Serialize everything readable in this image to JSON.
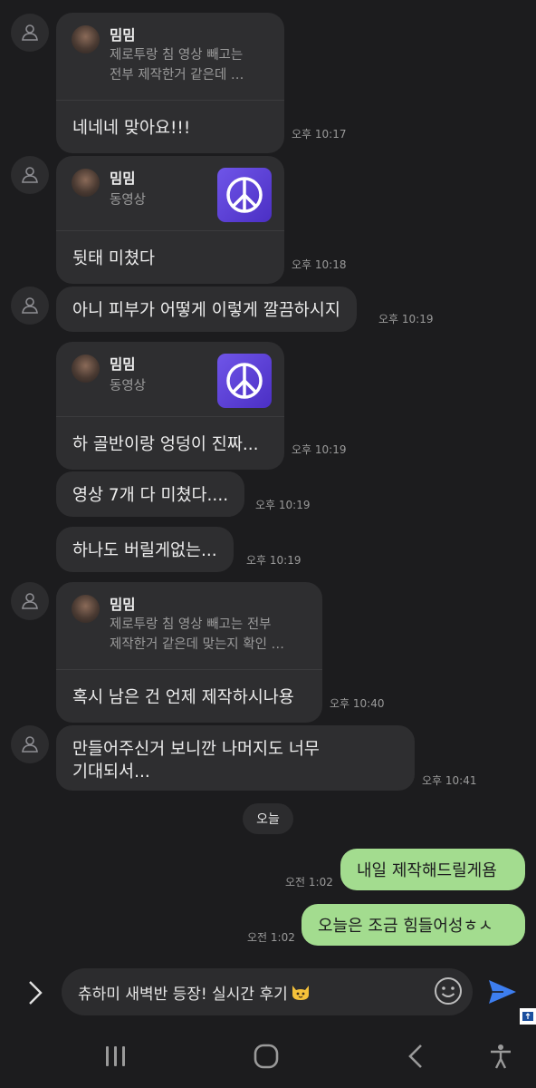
{
  "messages": [
    {
      "sender": "밈밈",
      "reply_type": "text",
      "reply_text": "제로투랑 침 영상 빼고는\n전부 제작한거 같은데 …",
      "body": "네네네 맞아요!!!",
      "time": "오후 10:17"
    },
    {
      "sender": "밈밈",
      "reply_type": "video",
      "reply_text": "동영상",
      "body": "뒷태 미쳤다",
      "time": "오후 10:18"
    },
    {
      "body": "아니 피부가 어떻게 이렇게 깔끔하시지",
      "time": "오후 10:19"
    },
    {
      "sender": "밈밈",
      "reply_type": "video",
      "reply_text": "동영상",
      "body": "하 골반이랑 엉덩이 진짜...",
      "time": "오후 10:19"
    },
    {
      "body": "영상 7개 다 미쳤다....",
      "time": "오후 10:19"
    },
    {
      "body": "하나도 버릴게없는...",
      "time": "오후 10:19"
    },
    {
      "sender": "밈밈",
      "reply_type": "text",
      "reply_text": "제로투랑 침 영상 빼고는 전부\n제작한거 같은데 맞는지 확인 …",
      "body": "혹시 남은 건 언제 제작하시나용",
      "time": "오후 10:40"
    },
    {
      "body_lines": [
        "만들어주신거 보니깐 나머지도 너무",
        "기대되서..."
      ],
      "time": "오후 10:41"
    }
  ],
  "date_divider": "오늘",
  "my_messages": [
    {
      "text": "내일 제작해드릴게욤",
      "time": "오전 1:02"
    },
    {
      "text": "오늘은 조금 힘들어성ㅎㅅ",
      "time": "오전 1:02"
    }
  ],
  "input": {
    "value": "츄하미 새벽반 등장! 실시간 후기"
  },
  "colors": {
    "my_bubble": "#a3dc8f",
    "their_bubble": "#2e2e30",
    "background": "#1c1c1e",
    "send": "#3d7ef0"
  }
}
